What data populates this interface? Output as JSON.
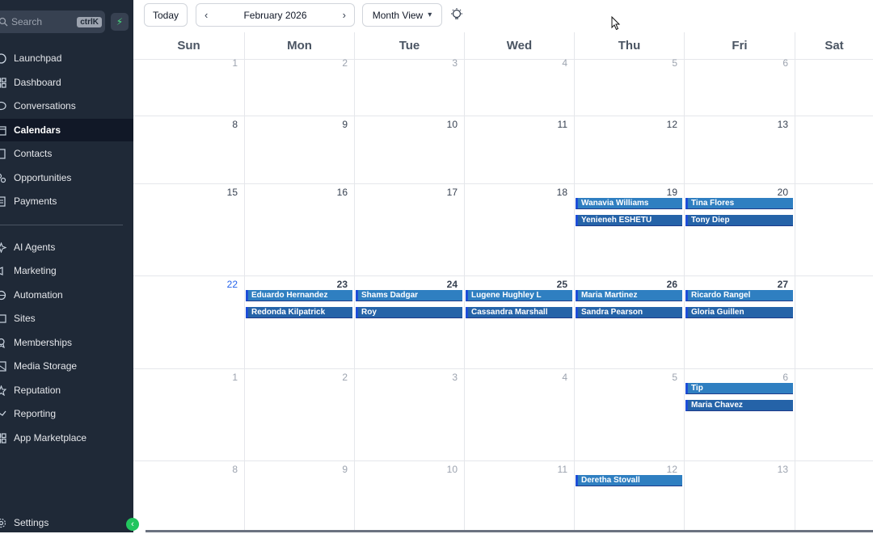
{
  "sidebar": {
    "search_placeholder": "Search",
    "search_shortcut": "ctrlK",
    "items": [
      {
        "label": "Launchpad",
        "icon": "rocket-icon"
      },
      {
        "label": "Dashboard",
        "icon": "dashboard-icon"
      },
      {
        "label": "Conversations",
        "icon": "chat-icon"
      },
      {
        "label": "Calendars",
        "icon": "calendar-icon",
        "active": true
      },
      {
        "label": "Contacts",
        "icon": "contacts-icon"
      },
      {
        "label": "Opportunities",
        "icon": "opportunities-icon"
      },
      {
        "label": "Payments",
        "icon": "payments-icon"
      },
      {
        "label": "AI Agents",
        "icon": "sparkle-icon"
      },
      {
        "label": "Marketing",
        "icon": "megaphone-icon"
      },
      {
        "label": "Automation",
        "icon": "automation-icon"
      },
      {
        "label": "Sites",
        "icon": "sites-icon"
      },
      {
        "label": "Memberships",
        "icon": "membership-icon"
      },
      {
        "label": "Media Storage",
        "icon": "image-icon"
      },
      {
        "label": "Reputation",
        "icon": "star-icon"
      },
      {
        "label": "Reporting",
        "icon": "trend-icon"
      },
      {
        "label": "App Marketplace",
        "icon": "apps-icon"
      }
    ],
    "settings_label": "Settings"
  },
  "toolbar": {
    "today_label": "Today",
    "month_label": "February 2026",
    "view_label": "Month View"
  },
  "calendar": {
    "weekdays": [
      "Sun",
      "Mon",
      "Tue",
      "Wed",
      "Thu",
      "Fri",
      "Sat"
    ],
    "weeks": [
      [
        "1",
        "2",
        "3",
        "4",
        "5",
        "6",
        ""
      ],
      [
        "8",
        "9",
        "10",
        "11",
        "12",
        "13",
        ""
      ],
      [
        "15",
        "16",
        "17",
        "18",
        "19",
        "20",
        ""
      ],
      [
        "22",
        "23",
        "24",
        "25",
        "26",
        "27",
        ""
      ],
      [
        "1",
        "2",
        "3",
        "4",
        "5",
        "6",
        ""
      ],
      [
        "8",
        "9",
        "10",
        "11",
        "12",
        "13",
        ""
      ]
    ],
    "today_date": "22",
    "events": {
      "w2_thu": [
        "Wanavia Williams",
        "Yenieneh ESHETU"
      ],
      "w2_fri": [
        "Tina Flores",
        "Tony Diep"
      ],
      "w3_mon": [
        "Eduardo Hernandez",
        "Redonda Kilpatrick"
      ],
      "w3_tue": [
        "Shams Dadgar",
        "Roy"
      ],
      "w3_wed": [
        "Lugene Hughley L",
        "Cassandra Marshall"
      ],
      "w3_thu": [
        "Maria Martinez",
        "Sandra Pearson"
      ],
      "w3_fri": [
        "Ricardo Rangel",
        "Gloria Guillen"
      ],
      "w4_fri": [
        "Tip",
        "Maria Chavez"
      ],
      "w5_thu": [
        "Deretha Stovall"
      ]
    }
  },
  "colors": {
    "sidebar_bg": "#1f2937",
    "event_bg": "#2f7fc1",
    "today_num": "#2563eb",
    "accent_green": "#22c55e"
  }
}
